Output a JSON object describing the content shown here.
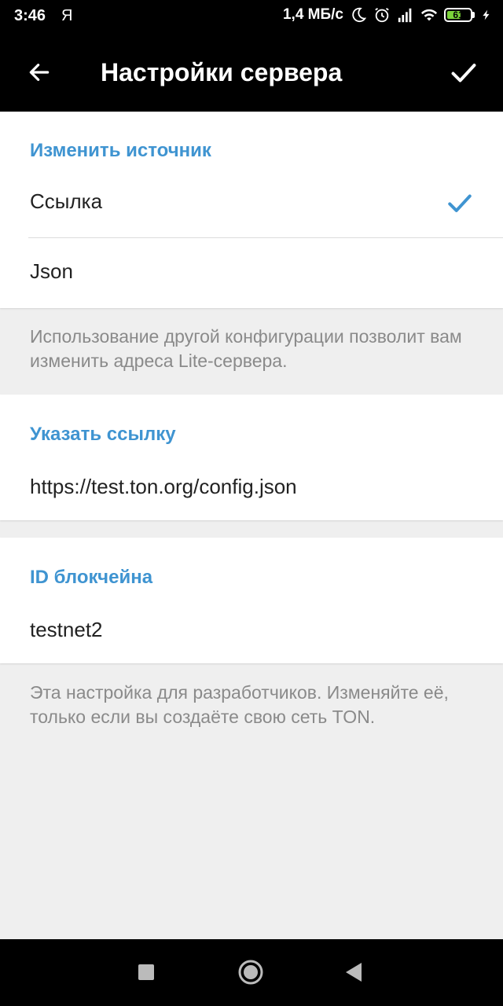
{
  "status_bar": {
    "time": "3:46",
    "carrier_glyph": "Я",
    "speed": "1,4 МБ/с",
    "battery_level": "61",
    "battery_color": "#7bd33a",
    "icons": [
      "moon-icon",
      "alarm-icon",
      "signal-icon",
      "wifi-icon",
      "battery-icon",
      "charging-icon"
    ]
  },
  "app_bar": {
    "title": "Настройки сервера",
    "back_icon": "arrow-left-icon",
    "done_icon": "check-icon"
  },
  "source_section": {
    "header": "Изменить источник",
    "options": [
      {
        "label": "Ссылка",
        "selected": true
      },
      {
        "label": "Json",
        "selected": false
      }
    ],
    "info": "Использование другой конфигурации позволит вам изменить адреса Lite-сервера."
  },
  "link_section": {
    "header": "Указать ссылку",
    "value": "https://test.ton.org/config.json"
  },
  "blockchain_section": {
    "header": "ID блокчейна",
    "value": "testnet2",
    "info": "Эта настройка для разработчиков. Изменяйте её, только если вы создаёте свою сеть TON."
  },
  "colors": {
    "accent": "#3f94d1",
    "background": "#efefef",
    "bar": "#000000"
  },
  "nav_bar": {
    "icons": [
      "recents-square-icon",
      "home-circle-icon",
      "back-triangle-icon"
    ]
  }
}
